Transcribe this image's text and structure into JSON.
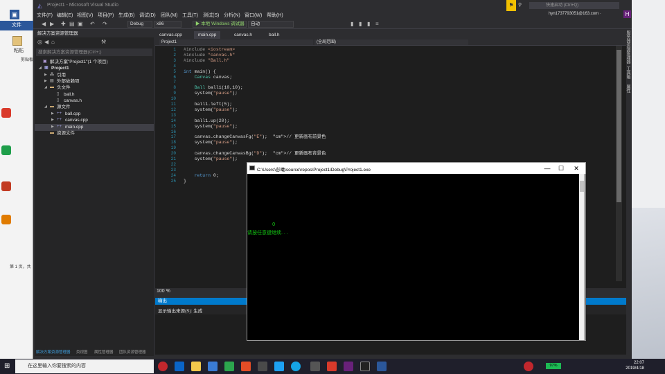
{
  "word": {
    "save_icon": "save-icon",
    "file_tab": "文件",
    "paste_label": "粘贴",
    "clipboard_label": "剪贴板",
    "status": "第 1 页，共"
  },
  "vs": {
    "title": "Project1 - Microsoft Visual Studio",
    "quick_launch": "快速启动 (Ctrl+Q)",
    "account": "hyn1737793051@163.com ·",
    "avatar": "H",
    "menu": [
      "文件(F)",
      "编辑(E)",
      "视图(V)",
      "项目(P)",
      "生成(B)",
      "调试(D)",
      "团队(M)",
      "工具(T)",
      "测试(S)",
      "分析(N)",
      "窗口(W)",
      "帮助(H)"
    ],
    "toolbar": {
      "config": "Debug",
      "platform": "x86",
      "run_label": "▶ 本地 Windows 调试器",
      "run_mode": "自动"
    }
  },
  "solution_explorer": {
    "title": "解决方案资源管理器",
    "search_placeholder": "搜索解决方案资源管理器(Ctrl+;)",
    "nodes": [
      {
        "label": "解决方案\"Project1\"(1 个项目)"
      },
      {
        "label": "Project1"
      },
      {
        "label": "引用"
      },
      {
        "label": "外部依赖项"
      },
      {
        "label": "头文件"
      },
      {
        "label": "ball.h"
      },
      {
        "label": "canvas.h"
      },
      {
        "label": "源文件"
      },
      {
        "label": "ball.cpp"
      },
      {
        "label": "canvas.cpp"
      },
      {
        "label": "main.cpp"
      },
      {
        "label": "资源文件"
      }
    ],
    "bottom_tabs": [
      "解决方案资源管理器",
      "类视图",
      "属性管理器",
      "团队资源管理器"
    ]
  },
  "editor": {
    "tabs": [
      "canvas.cpp",
      "main.cpp",
      "canvas.h",
      "ball.h"
    ],
    "nav_project": "Project1",
    "nav_scope": "(全局范围)",
    "zoom": "100 %",
    "lines": [
      {
        "n": "1",
        "t": "#include <iostream>"
      },
      {
        "n": "2",
        "t": "#include \"canvas.h\""
      },
      {
        "n": "3",
        "t": "#include \"Ball.h\""
      },
      {
        "n": "4",
        "t": ""
      },
      {
        "n": "5",
        "t": "int main() {"
      },
      {
        "n": "6",
        "t": "    Canvas canvas;"
      },
      {
        "n": "7",
        "t": ""
      },
      {
        "n": "8",
        "t": "    Ball ball1(10,10);"
      },
      {
        "n": "9",
        "t": "    system(\"pause\");"
      },
      {
        "n": "10",
        "t": ""
      },
      {
        "n": "11",
        "t": "    ball1.left(5);"
      },
      {
        "n": "12",
        "t": "    system(\"pause\");"
      },
      {
        "n": "13",
        "t": ""
      },
      {
        "n": "14",
        "t": "    ball1.up(20);"
      },
      {
        "n": "15",
        "t": "    system(\"pause\");"
      },
      {
        "n": "16",
        "t": ""
      },
      {
        "n": "17",
        "t": "    canvas.changeCanvasFg(\"E\");  // 更新画布前景色"
      },
      {
        "n": "18",
        "t": "    system(\"pause\");"
      },
      {
        "n": "19",
        "t": ""
      },
      {
        "n": "20",
        "t": "    canvas.changeCanvasBg(\"D\");  // 更新画布背景色"
      },
      {
        "n": "21",
        "t": "    system(\"pause\");"
      },
      {
        "n": "22",
        "t": ""
      },
      {
        "n": "23",
        "t": ""
      },
      {
        "n": "24",
        "t": "    return 0;"
      },
      {
        "n": "25",
        "t": "}"
      }
    ]
  },
  "output": {
    "title": "输出",
    "source_label": "显示输出来源(S): 生成"
  },
  "right_tabs": [
    "服务器资源管理器",
    "工具箱",
    "属性"
  ],
  "console": {
    "title": "C:\\Users\\彭曦\\source\\repos\\Project1\\Debug\\Project1.exe",
    "ball": "O",
    "message": "请按任意键继续. . .",
    "min": "—",
    "max": "☐",
    "close": "✕"
  },
  "taskbar": {
    "search_placeholder": "在这里输入你要搜索的内容",
    "battery": "97%",
    "time": "22:07",
    "date": "2019/4/18"
  },
  "colors": {
    "vs_bg": "#2d2d30",
    "editor_bg": "#1e1e1e",
    "accent": "#007acc",
    "console_text": "#13c313",
    "keyword": "#569cd6",
    "string": "#d69d85",
    "comment": "#57a64a"
  }
}
